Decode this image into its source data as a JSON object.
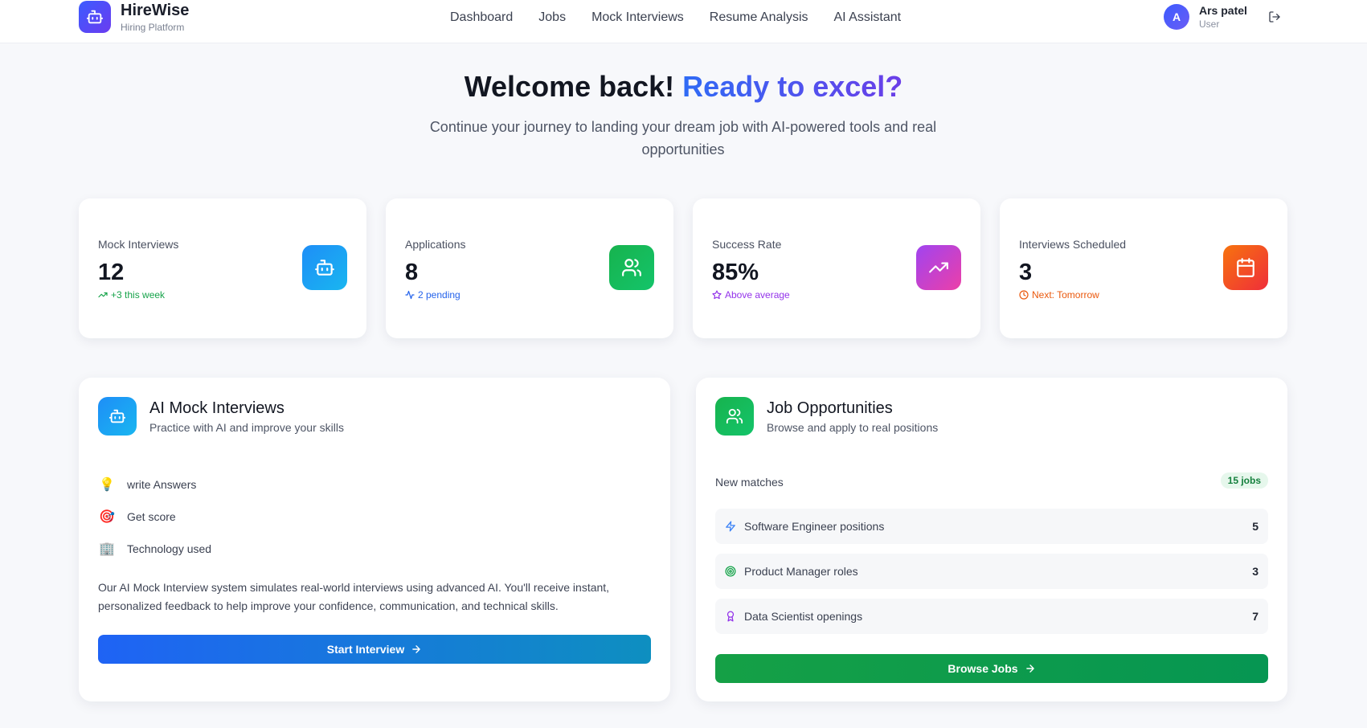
{
  "brand": {
    "name": "HireWise",
    "subtitle": "Hiring Platform",
    "logo_icon": "robot-icon"
  },
  "nav": {
    "items": [
      {
        "label": "Dashboard"
      },
      {
        "label": "Jobs"
      },
      {
        "label": "Mock Interviews"
      },
      {
        "label": "Resume Analysis"
      },
      {
        "label": "AI Assistant"
      }
    ]
  },
  "user": {
    "initial": "A",
    "name": "Ars patel",
    "role": "User",
    "logout_icon": "logout-icon"
  },
  "hero": {
    "title_plain": "Welcome back!",
    "title_accent": "Ready to excel?",
    "subtitle": "Continue your journey to landing your dream job with AI-powered tools and real opportunities"
  },
  "stats": [
    {
      "label": "Mock Interviews",
      "value": "12",
      "note": "+3 this week",
      "note_color": "#16a34a",
      "note_icon": "trending-up-icon",
      "icon": "robot-icon",
      "gradient": [
        "#1e8ef7",
        "#19b6f0"
      ]
    },
    {
      "label": "Applications",
      "value": "8",
      "note": "2 pending",
      "note_color": "#2563eb",
      "note_icon": "activity-icon",
      "icon": "users-icon",
      "gradient": [
        "#17b34e",
        "#14c46a"
      ]
    },
    {
      "label": "Success Rate",
      "value": "85%",
      "note": "Above average",
      "note_color": "#9333ea",
      "note_icon": "star-icon",
      "icon": "trending-up-icon",
      "gradient": [
        "#a044f0",
        "#ec3fa8"
      ]
    },
    {
      "label": "Interviews Scheduled",
      "value": "3",
      "note": "Next: Tomorrow",
      "note_color": "#ea580c",
      "note_icon": "clock-icon",
      "icon": "calendar-icon",
      "gradient": [
        "#f7730e",
        "#ef2e3a"
      ]
    }
  ],
  "mock_panel": {
    "title": "AI Mock Interviews",
    "subtitle": "Practice with AI and improve your skills",
    "features": [
      {
        "emoji": "💡",
        "label": "write Answers",
        "icon": "lightbulb-icon"
      },
      {
        "emoji": "🎯",
        "label": "Get score",
        "icon": "target-icon"
      },
      {
        "emoji": "🏢",
        "label": "Technology used",
        "icon": "building-icon"
      }
    ],
    "description": "Our AI Mock Interview system simulates real-world interviews using advanced AI. You'll receive instant, personalized feedback to help improve your confidence, communication, and technical skills.",
    "button_label": "Start Interview"
  },
  "jobs_panel": {
    "title": "Job Opportunities",
    "subtitle": "Browse and apply to real positions",
    "matches_label": "New matches",
    "matches_badge": "15 jobs",
    "rows": [
      {
        "label": "Software Engineer positions",
        "count": "5",
        "icon": "zap-icon",
        "color": "#3b82f6"
      },
      {
        "label": "Product Manager roles",
        "count": "3",
        "icon": "target-icon",
        "color": "#16a34a"
      },
      {
        "label": "Data Scientist openings",
        "count": "7",
        "icon": "award-icon",
        "color": "#9333ea"
      }
    ],
    "button_label": "Browse Jobs"
  }
}
